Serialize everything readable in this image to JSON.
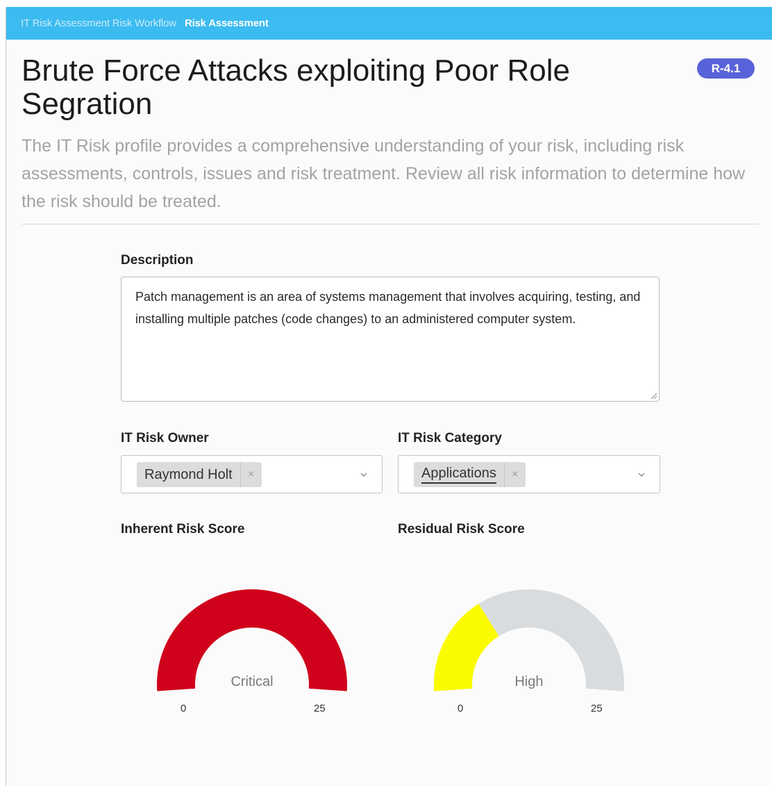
{
  "breadcrumb": {
    "parent": "IT Risk Assessment Risk Workflow",
    "current": "Risk Assessment"
  },
  "page": {
    "title": "Brute Force Attacks exploiting Poor Role Segration",
    "badge": "R-4.1",
    "subtitle": "The IT Risk profile provides a comprehensive understanding of your risk, including risk assessments, controls, issues and risk treatment. Review all risk information to determine how the risk should be treated."
  },
  "description": {
    "label": "Description",
    "value": "Patch management is an area of systems management that involves acquiring, testing, and installing multiple patches (code changes) to an administered computer system."
  },
  "owner": {
    "label": "IT Risk Owner",
    "chip": "Raymond Holt",
    "remove": "×"
  },
  "category": {
    "label": "IT Risk Category",
    "chip": "Applications",
    "remove": "×"
  },
  "inherent": {
    "label": "Inherent Risk Score",
    "level": "Critical",
    "min": "0",
    "max": "25",
    "fill_fraction": 1.0,
    "color": "#d0021b"
  },
  "residual": {
    "label": "Residual Risk Score",
    "level": "High",
    "min": "0",
    "max": "25",
    "fill_fraction": 0.33,
    "color": "#fbfb00"
  },
  "colors": {
    "topbar": "#3bbbf0",
    "badge": "#5863d9",
    "gauge_track": "#d9dcdf"
  }
}
